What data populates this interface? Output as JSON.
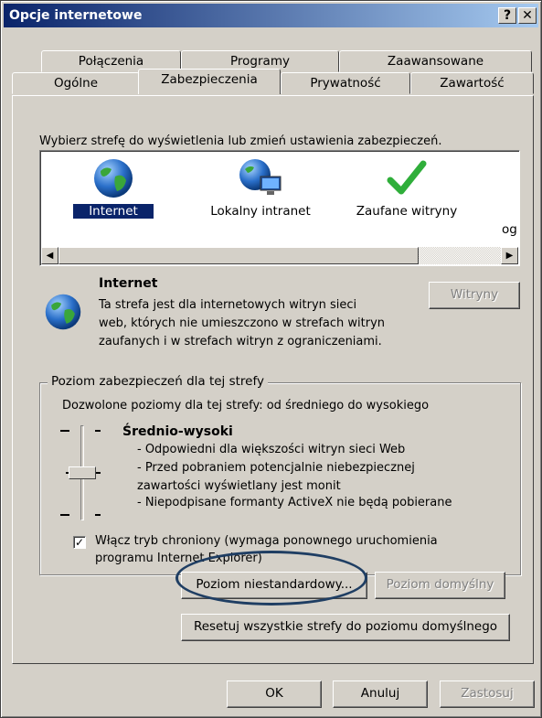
{
  "window": {
    "title": "Opcje internetowe",
    "help_label": "?",
    "close_label": "✕"
  },
  "tabs_back": [
    "Połączenia",
    "Programy",
    "Zaawansowane"
  ],
  "tabs_front": [
    "Ogólne",
    "Zabezpieczenia",
    "Prywatność",
    "Zawartość"
  ],
  "active_tab": "Zabezpieczenia",
  "zones": {
    "prompt": "Wybierz strefę do wyświetlenia lub zmień ustawienia zabezpieczeń.",
    "items": [
      {
        "label": "Internet",
        "icon": "globe-icon",
        "selected": true
      },
      {
        "label": "Lokalny intranet",
        "icon": "intranet-globe-icon",
        "selected": false
      },
      {
        "label": "Zaufane witryny",
        "icon": "checkmark-icon",
        "selected": false
      }
    ],
    "cut_label": "og"
  },
  "zone_info": {
    "title": "Internet",
    "description": [
      "Ta strefa jest dla internetowych witryn sieci",
      "web, których nie umieszczono w strefach witryn",
      "zaufanych i w strefach witryn z ograniczeniami."
    ],
    "sites_button": "Witryny"
  },
  "security_level": {
    "group_title": "Poziom zabezpieczeń dla tej strefy",
    "allowed": "Dozwolone poziomy dla tej strefy: od średniego do wysokiego",
    "level_name": "Średnio-wysoki",
    "level_bullets": [
      "- Odpowiedni dla większości witryn sieci Web",
      "- Przed pobraniem potencjalnie niebezpiecznej",
      "zawartości wyświetlany jest monit",
      "- Niepodpisane formanty ActiveX nie będą pobierane"
    ],
    "slider_position": "Średnio-wysoki",
    "protected_mode_label_1": "Włącz tryb chroniony (wymaga ponownego uruchomienia",
    "protected_mode_label_2": "programu Internet Explorer)",
    "protected_mode_checked": true,
    "custom_button": "Poziom niestandardowy...",
    "default_button": "Poziom domyślny"
  },
  "reset_button": "Resetuj wszystkie strefy do poziomu domyślnego",
  "footer": {
    "ok": "OK",
    "cancel": "Anuluj",
    "apply": "Zastosuj"
  },
  "colors": {
    "face": "#d4d0c8",
    "title_start": "#0a246a",
    "title_end": "#a6caf0",
    "annotation": "#1f3e63"
  }
}
